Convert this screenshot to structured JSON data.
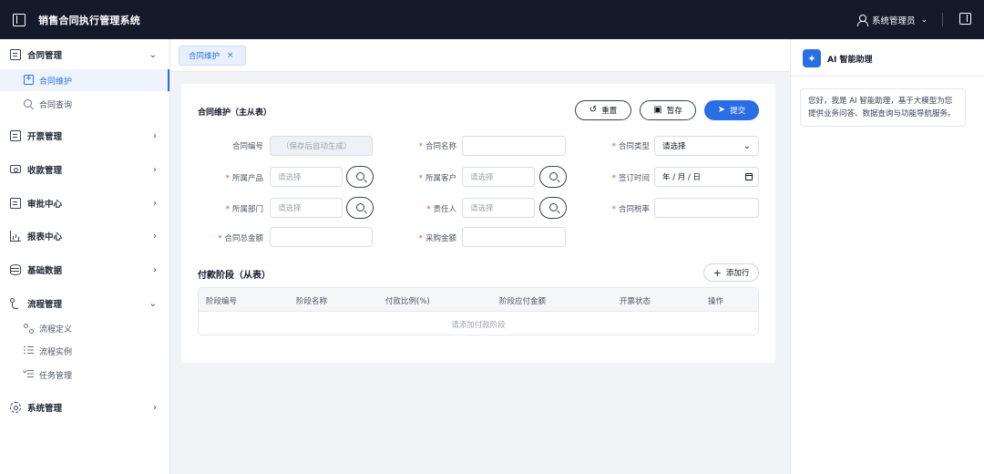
{
  "app": {
    "title": "销售合同执行管理系统",
    "user_name": "系统管理员",
    "user_caret": "⌄"
  },
  "sidebar": {
    "groups": [
      {
        "label": "合同管理",
        "chevron": "⌄"
      },
      {
        "label": "开票管理",
        "chevron": "›"
      },
      {
        "label": "收款管理",
        "chevron": "›"
      },
      {
        "label": "审批中心",
        "chevron": "›"
      },
      {
        "label": "报表中心",
        "chevron": "›"
      },
      {
        "label": "基础数据",
        "chevron": "›"
      },
      {
        "label": "流程管理",
        "chevron": "⌄"
      },
      {
        "label": "系统管理",
        "chevron": "›"
      }
    ],
    "contract_items": [
      {
        "label": "合同维护"
      },
      {
        "label": "合同查询"
      }
    ],
    "flow_items": [
      {
        "label": "流程定义"
      },
      {
        "label": "流程实例"
      },
      {
        "label": "任务管理"
      }
    ]
  },
  "tabs": [
    {
      "label": "合同维护",
      "close": "×"
    }
  ],
  "form": {
    "title": "合同维护（主从表）",
    "buttons": {
      "reset": "重置",
      "save_draft": "暂存",
      "submit": "提交"
    },
    "fields": {
      "contract_no": {
        "label": "合同编号",
        "value": "（保存后自动生成）"
      },
      "contract_name": {
        "label": "合同名称",
        "required": "*",
        "value": ""
      },
      "contract_type": {
        "label": "合同类型",
        "required": "*",
        "value": "请选择"
      },
      "product": {
        "label": "所属产品",
        "required": "*",
        "placeholder": "请选择"
      },
      "customer": {
        "label": "所属客户",
        "required": "*",
        "placeholder": "请选择"
      },
      "sign_date": {
        "label": "签订时间",
        "required": "*",
        "value": "年 / 月 / 日"
      },
      "department": {
        "label": "所属部门",
        "required": "*",
        "placeholder": "请选择"
      },
      "owner": {
        "label": "责任人",
        "required": "*",
        "placeholder": "请选择"
      },
      "tax_rate": {
        "label": "合同税率",
        "required": "*",
        "value": ""
      },
      "total_amount": {
        "label": "合同总金额",
        "required": "*",
        "value": ""
      },
      "purchase_amount": {
        "label": "采购金额",
        "required": "*",
        "value": ""
      }
    }
  },
  "payment": {
    "title": "付款阶段（从表）",
    "add_label": "添加行",
    "columns": [
      "阶段编号",
      "阶段名称",
      "付款比例(%)",
      "阶段应付金额",
      "开票状态",
      "操作"
    ],
    "empty_text": "请添加付款阶段"
  },
  "ai": {
    "badge": "✦",
    "title": "AI 智能助理",
    "message": "您好，我是 AI 智能助理，基于大模型为您提供业务问答、数据查询与功能导航服务。"
  },
  "colors": {
    "accent": "#2a6ee5",
    "topbar": "#141a2a",
    "required": "#e5484d"
  }
}
